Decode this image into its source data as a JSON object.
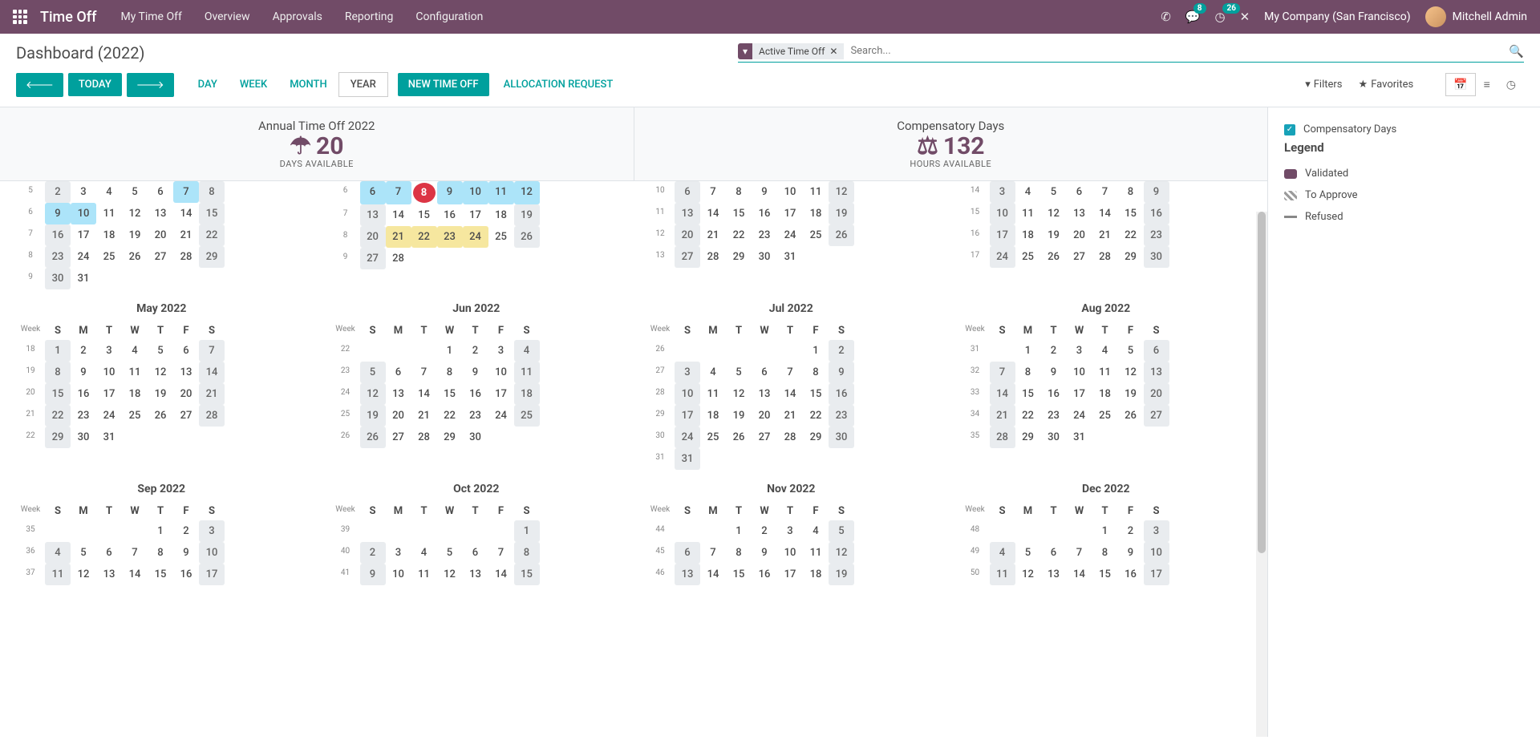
{
  "nav": {
    "brand": "Time Off",
    "items": [
      "My Time Off",
      "Overview",
      "Approvals",
      "Reporting",
      "Configuration"
    ],
    "msg_badge": "8",
    "act_badge": "26",
    "company": "My Company (San Francisco)",
    "user": "Mitchell Admin"
  },
  "page_title": "Dashboard (2022)",
  "search": {
    "facet_label": "Active Time Off",
    "placeholder": "Search..."
  },
  "tb": {
    "today": "TODAY",
    "day": "DAY",
    "week": "WEEK",
    "month": "MONTH",
    "year": "YEAR",
    "newto": "NEW TIME OFF",
    "alloc": "ALLOCATION REQUEST",
    "filters": "Filters",
    "fav": "Favorites"
  },
  "summary": {
    "a_title": "Annual Time Off 2022",
    "a_val": "20",
    "a_sub": "DAYS AVAILABLE",
    "b_title": "Compensatory Days",
    "b_val": "132",
    "b_sub": "HOURS AVAILABLE"
  },
  "legend": {
    "comp": "Compensatory Days",
    "title": "Legend",
    "v": "Validated",
    "a": "To Approve",
    "r": "Refused"
  },
  "dow": [
    "S",
    "M",
    "T",
    "W",
    "T",
    "F",
    "S"
  ],
  "wk_label": "Week",
  "m": {
    "r1": [
      {
        "weeks": [
          5,
          6,
          7,
          8,
          9
        ],
        "days": [
          [
            2,
            3,
            4,
            5,
            6,
            7,
            8
          ],
          [
            9,
            10,
            11,
            12,
            13,
            14,
            15
          ],
          [
            16,
            17,
            18,
            19,
            20,
            21,
            22
          ],
          [
            23,
            24,
            25,
            26,
            27,
            28,
            29
          ],
          [
            30,
            31,
            0,
            0,
            0,
            0,
            0
          ]
        ],
        "approved": [
          7,
          9,
          10
        ],
        "toapprove": [],
        "today": null
      },
      {
        "weeks": [
          6,
          7,
          8,
          9
        ],
        "days": [
          [
            6,
            7,
            8,
            9,
            10,
            11,
            12
          ],
          [
            13,
            14,
            15,
            16,
            17,
            18,
            19
          ],
          [
            20,
            21,
            22,
            23,
            24,
            25,
            26
          ],
          [
            27,
            28,
            0,
            0,
            0,
            0,
            0
          ]
        ],
        "approved": [
          6,
          7,
          9,
          10,
          11,
          12
        ],
        "toapprove": [
          21,
          22,
          23,
          24
        ],
        "today": 8
      },
      {
        "weeks": [
          10,
          11,
          12,
          13
        ],
        "days": [
          [
            6,
            7,
            8,
            9,
            10,
            11,
            12
          ],
          [
            13,
            14,
            15,
            16,
            17,
            18,
            19
          ],
          [
            20,
            21,
            22,
            23,
            24,
            25,
            26
          ],
          [
            27,
            28,
            29,
            30,
            31,
            0,
            0
          ]
        ],
        "approved": [],
        "toapprove": [],
        "today": null
      },
      {
        "weeks": [
          14,
          15,
          16,
          17
        ],
        "days": [
          [
            3,
            4,
            5,
            6,
            7,
            8,
            9
          ],
          [
            10,
            11,
            12,
            13,
            14,
            15,
            16
          ],
          [
            17,
            18,
            19,
            20,
            21,
            22,
            23
          ],
          [
            24,
            25,
            26,
            27,
            28,
            29,
            30
          ]
        ],
        "approved": [],
        "toapprove": [],
        "today": null
      }
    ],
    "r2": [
      {
        "name": "May 2022",
        "weeks": [
          18,
          19,
          20,
          21,
          22
        ],
        "days": [
          [
            1,
            2,
            3,
            4,
            5,
            6,
            7
          ],
          [
            8,
            9,
            10,
            11,
            12,
            13,
            14
          ],
          [
            15,
            16,
            17,
            18,
            19,
            20,
            21
          ],
          [
            22,
            23,
            24,
            25,
            26,
            27,
            28
          ],
          [
            29,
            30,
            31,
            0,
            0,
            0,
            0
          ]
        ]
      },
      {
        "name": "Jun 2022",
        "weeks": [
          22,
          23,
          24,
          25,
          26
        ],
        "days": [
          [
            0,
            0,
            0,
            1,
            2,
            3,
            4
          ],
          [
            5,
            6,
            7,
            8,
            9,
            10,
            11
          ],
          [
            12,
            13,
            14,
            15,
            16,
            17,
            18
          ],
          [
            19,
            20,
            21,
            22,
            23,
            24,
            25
          ],
          [
            26,
            27,
            28,
            29,
            30,
            0,
            0
          ]
        ]
      },
      {
        "name": "Jul 2022",
        "weeks": [
          26,
          27,
          28,
          29,
          30,
          31
        ],
        "days": [
          [
            0,
            0,
            0,
            0,
            0,
            1,
            2
          ],
          [
            3,
            4,
            5,
            6,
            7,
            8,
            9
          ],
          [
            10,
            11,
            12,
            13,
            14,
            15,
            16
          ],
          [
            17,
            18,
            19,
            20,
            21,
            22,
            23
          ],
          [
            24,
            25,
            26,
            27,
            28,
            29,
            30
          ],
          [
            31,
            0,
            0,
            0,
            0,
            0,
            0
          ]
        ]
      },
      {
        "name": "Aug 2022",
        "weeks": [
          31,
          32,
          33,
          34,
          35
        ],
        "days": [
          [
            0,
            1,
            2,
            3,
            4,
            5,
            6
          ],
          [
            7,
            8,
            9,
            10,
            11,
            12,
            13
          ],
          [
            14,
            15,
            16,
            17,
            18,
            19,
            20
          ],
          [
            21,
            22,
            23,
            24,
            25,
            26,
            27
          ],
          [
            28,
            29,
            30,
            31,
            0,
            0,
            0
          ]
        ]
      }
    ],
    "r3": [
      {
        "name": "Sep 2022",
        "weeks": [
          35,
          36,
          37
        ],
        "days": [
          [
            0,
            0,
            0,
            0,
            1,
            2,
            3
          ],
          [
            4,
            5,
            6,
            7,
            8,
            9,
            10
          ],
          [
            11,
            12,
            13,
            14,
            15,
            16,
            17
          ]
        ]
      },
      {
        "name": "Oct 2022",
        "weeks": [
          39,
          40,
          41
        ],
        "days": [
          [
            0,
            0,
            0,
            0,
            0,
            0,
            1
          ],
          [
            2,
            3,
            4,
            5,
            6,
            7,
            8
          ],
          [
            9,
            10,
            11,
            12,
            13,
            14,
            15
          ]
        ]
      },
      {
        "name": "Nov 2022",
        "weeks": [
          44,
          45,
          46
        ],
        "days": [
          [
            0,
            0,
            1,
            2,
            3,
            4,
            5
          ],
          [
            6,
            7,
            8,
            9,
            10,
            11,
            12
          ],
          [
            13,
            14,
            15,
            16,
            17,
            18,
            19
          ]
        ]
      },
      {
        "name": "Dec 2022",
        "weeks": [
          48,
          49,
          50
        ],
        "days": [
          [
            0,
            0,
            0,
            0,
            1,
            2,
            3
          ],
          [
            4,
            5,
            6,
            7,
            8,
            9,
            10
          ],
          [
            11,
            12,
            13,
            14,
            15,
            16,
            17
          ]
        ]
      }
    ]
  }
}
